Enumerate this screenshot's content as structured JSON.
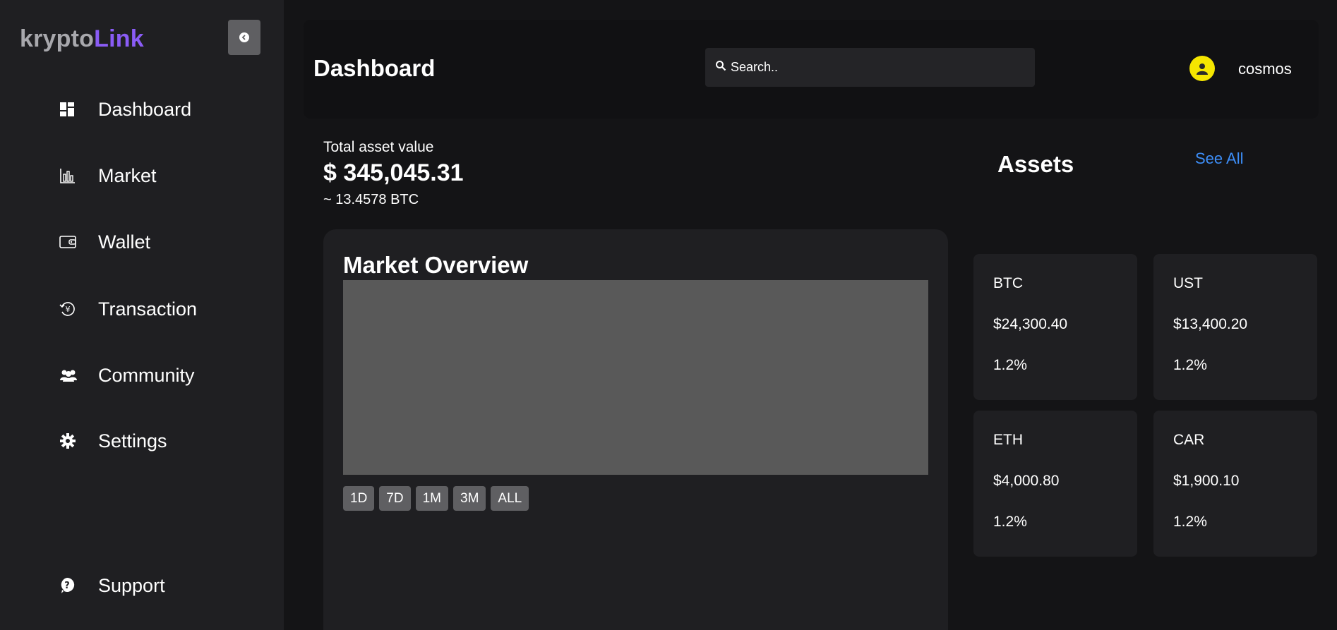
{
  "brand": {
    "part1": "krypto",
    "part2": "Link"
  },
  "sidebar": {
    "collapse_icon": "chevron-left-icon",
    "items": [
      {
        "label": "Dashboard",
        "icon": "dashboard-icon"
      },
      {
        "label": "Market",
        "icon": "bar-chart-icon"
      },
      {
        "label": "Wallet",
        "icon": "wallet-icon"
      },
      {
        "label": "Transaction",
        "icon": "transaction-icon"
      },
      {
        "label": "Community",
        "icon": "community-icon"
      },
      {
        "label": "Settings",
        "icon": "gear-icon"
      }
    ],
    "support": {
      "label": "Support",
      "icon": "help-icon"
    }
  },
  "header": {
    "title": "Dashboard",
    "search_placeholder": "Search..",
    "username": "cosmos"
  },
  "summary": {
    "label": "Total asset value",
    "value": "$ 345,045.31",
    "btc": "~ 13.4578 BTC"
  },
  "market": {
    "title": "Market Overview",
    "ranges": [
      "1D",
      "7D",
      "1M",
      "3M",
      "ALL"
    ]
  },
  "assets": {
    "title": "Assets",
    "see_all": "See All",
    "items": [
      {
        "symbol": "BTC",
        "price": "$24,300.40",
        "change": "1.2%"
      },
      {
        "symbol": "UST",
        "price": "$13,400.20",
        "change": "1.2%"
      },
      {
        "symbol": "ETH",
        "price": "$4,000.80",
        "change": "1.2%"
      },
      {
        "symbol": "CAR",
        "price": "$1,900.10",
        "change": "1.2%"
      }
    ]
  },
  "colors": {
    "accent": "#8a5cf6",
    "link": "#3d8ef8",
    "avatar": "#f5e600",
    "sidebar_bg": "#1f1f22",
    "page_bg": "#141416"
  }
}
